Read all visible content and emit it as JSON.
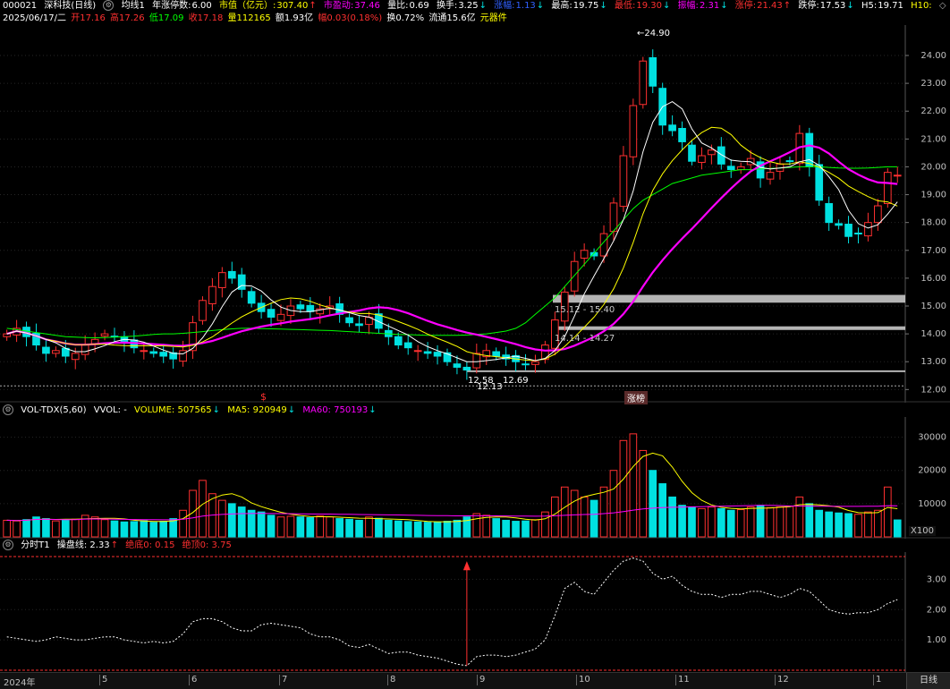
{
  "header": {
    "code": "000021",
    "name": "深科技(日线)",
    "ma_label": "均线1",
    "stop_label": "年涨停数:",
    "stop_value": "6.00",
    "mcap_label": "市值（亿元）:",
    "mcap_value": "307.40",
    "dyn_pe_label": "市盈动:",
    "dyn_pe_value": "37.46",
    "vol_ratio_label": "量比:",
    "vol_ratio_value": "0.69",
    "turnover_label": "换手:",
    "turnover_value": "3.25",
    "chg_label": "涨幅:",
    "chg_value": "1.13",
    "high_label": "最高:",
    "high_value": "19.75",
    "low_label": "最低:",
    "low_value": "19.30",
    "amp_label": "振幅:",
    "amp_value": "2.31",
    "limit_up_label": "涨停:",
    "limit_up_value": "21.43",
    "limit_down_label": "跌停:",
    "limit_down_value": "17.53",
    "h5_label": "H5:",
    "h5_value": "19.71",
    "h10_label": "H10:"
  },
  "info": {
    "date": "2025/06/17/二",
    "open": "开17.16",
    "high": "高17.26",
    "low": "低17.09",
    "close": "收17.18",
    "volume": "量112165",
    "amount": "额1.93亿",
    "change": "幅0.03(0.18%)",
    "turnover": "换0.72%",
    "float": "流通15.6亿",
    "sector": "元器件"
  },
  "annotations": {
    "peak": "24.90",
    "zone1": "15.12 - 15.40",
    "zone2": "14.14 - 14.27",
    "low1": "12.58",
    "low2": "12.69",
    "low3": "12.13",
    "dollar": "$",
    "zhangting": "涨榜"
  },
  "volume_header": {
    "title": "VOL-TDX(5,60)",
    "vvol": "VVOL: -",
    "volume": "VOLUME: 507565",
    "ma5": "MA5: 920949",
    "ma60": "MA60: 750193",
    "unit": "X100"
  },
  "fenshi_header": {
    "title": "分时T1",
    "line": "操盘线: 2.33",
    "bottom": "绝底0: 0.15",
    "top": "绝顶0: 3.75"
  },
  "statusbar": {
    "year": "2024年",
    "tab": "日线",
    "months": [
      "5",
      "6",
      "7",
      "8",
      "9",
      "10",
      "11",
      "12",
      "1"
    ]
  },
  "colors": {
    "up": "#ff3030",
    "down": "#00e0e0",
    "ma5": "#ffffff",
    "ma10": "#ffff00",
    "ma20": "#ff00ff",
    "ma60": "#00ff00",
    "zone": "#c8c8c8"
  },
  "chart_data": [
    {
      "type": "candlestick",
      "yticks": [
        "24.00",
        "23.00",
        "22.00",
        "21.00",
        "20.00",
        "19.00",
        "18.00",
        "17.00",
        "16.00",
        "15.00",
        "14.00",
        "13.00",
        "12.00"
      ],
      "ylim": [
        11.85,
        24.9
      ],
      "close": [
        14.0,
        14.2,
        13.9,
        13.6,
        13.3,
        13.4,
        13.2,
        13.3,
        13.6,
        13.8,
        14.0,
        13.9,
        13.7,
        13.5,
        13.4,
        13.3,
        13.2,
        13.1,
        13.4,
        14.4,
        15.2,
        15.7,
        16.2,
        16.0,
        15.6,
        15.1,
        14.8,
        14.6,
        14.7,
        15.0,
        14.9,
        14.8,
        14.9,
        15.0,
        14.7,
        14.4,
        14.3,
        14.6,
        14.2,
        13.9,
        13.6,
        13.5,
        13.4,
        13.3,
        13.2,
        13.0,
        12.8,
        12.7,
        13.3,
        13.4,
        13.2,
        13.1,
        13.0,
        12.9,
        13.0,
        13.6,
        14.5,
        15.5,
        16.6,
        17.0,
        16.8,
        17.6,
        18.7,
        20.4,
        22.2,
        23.8,
        22.9,
        21.5,
        21.3,
        20.9,
        20.2,
        20.4,
        20.6,
        20.1,
        19.9,
        20.0,
        20.3,
        19.6,
        19.8,
        20.1,
        20.2,
        21.2,
        20.0,
        18.8,
        18.0,
        17.9,
        17.5,
        17.6,
        18.0,
        18.6,
        19.8,
        19.7
      ],
      "ma60": [
        14.2,
        14.15,
        14.1,
        14.05,
        14.0,
        13.95,
        13.9,
        13.88,
        13.87,
        13.86,
        13.87,
        13.88,
        13.9,
        13.92,
        13.95,
        13.98,
        14.0,
        14.0,
        14.02,
        14.05,
        14.08,
        14.12,
        14.15,
        14.18,
        14.2,
        14.2,
        14.19,
        14.18,
        14.17,
        14.16,
        14.15,
        14.14,
        14.13,
        14.12,
        14.1,
        14.08,
        14.06,
        14.04,
        14.02,
        14.0,
        13.98,
        13.97,
        13.96,
        13.95,
        13.95,
        13.95,
        13.95,
        13.96,
        13.98,
        14.0,
        14.05,
        14.1,
        14.2,
        14.4,
        14.7,
        15.0,
        15.3,
        15.7,
        16.1,
        16.5,
        16.9,
        17.3,
        17.7,
        18.1,
        18.5,
        18.8,
        19.0,
        19.2,
        19.4,
        19.5,
        19.6,
        19.7,
        19.75,
        19.8,
        19.85,
        19.9,
        19.9,
        19.92,
        19.94,
        19.96,
        19.98,
        20.0,
        20.0,
        20.0,
        19.98,
        19.96,
        19.95,
        19.95,
        19.96,
        19.98,
        20.0,
        20.0
      ]
    },
    {
      "type": "bar",
      "title": "VOL-TDX(5,60)",
      "yticks": [
        "30000",
        "20000",
        "10000"
      ],
      "ylim": [
        0,
        35000
      ],
      "values": [
        5000,
        4800,
        5200,
        6000,
        5500,
        4800,
        5000,
        5300,
        6500,
        6000,
        5200,
        4800,
        4500,
        4600,
        4900,
        4400,
        4700,
        5500,
        8000,
        14000,
        17000,
        13000,
        11000,
        10000,
        9000,
        8000,
        7500,
        6500,
        6000,
        6200,
        6000,
        5800,
        6300,
        6000,
        5500,
        5300,
        5000,
        6000,
        5600,
        5000,
        4800,
        4600,
        4500,
        4400,
        4500,
        4700,
        5000,
        6000,
        7000,
        6500,
        5500,
        5000,
        4700,
        4800,
        5200,
        7500,
        12000,
        15000,
        14000,
        12000,
        11000,
        15000,
        20000,
        29000,
        31000,
        26000,
        20000,
        16000,
        12000,
        9500,
        9000,
        8500,
        9000,
        8500,
        8000,
        8200,
        9000,
        9500,
        8800,
        9000,
        9200,
        12000,
        10000,
        8000,
        7500,
        7200,
        7000,
        6800,
        7500,
        8000,
        15000,
        5100
      ]
    },
    {
      "type": "line",
      "title": "分时T1",
      "yticks": [
        "3.00",
        "2.00",
        "1.00"
      ],
      "ylim": [
        0.0,
        3.75
      ],
      "values": [
        1.1,
        1.05,
        1.0,
        0.95,
        1.0,
        1.1,
        1.05,
        1.0,
        1.0,
        1.05,
        1.1,
        1.1,
        1.0,
        0.95,
        0.9,
        0.95,
        0.9,
        0.95,
        1.2,
        1.6,
        1.7,
        1.7,
        1.6,
        1.4,
        1.3,
        1.3,
        1.5,
        1.55,
        1.5,
        1.45,
        1.4,
        1.2,
        1.1,
        1.1,
        1.0,
        0.8,
        0.75,
        0.85,
        0.7,
        0.55,
        0.6,
        0.6,
        0.5,
        0.45,
        0.4,
        0.3,
        0.2,
        0.15,
        0.45,
        0.5,
        0.5,
        0.45,
        0.5,
        0.6,
        0.7,
        1.0,
        1.8,
        2.7,
        2.9,
        2.6,
        2.5,
        2.9,
        3.3,
        3.6,
        3.7,
        3.6,
        3.2,
        3.0,
        3.1,
        2.8,
        2.6,
        2.5,
        2.5,
        2.4,
        2.5,
        2.5,
        2.6,
        2.6,
        2.5,
        2.4,
        2.5,
        2.7,
        2.6,
        2.3,
        2.0,
        1.9,
        1.85,
        1.9,
        1.9,
        2.0,
        2.2,
        2.33
      ]
    }
  ]
}
